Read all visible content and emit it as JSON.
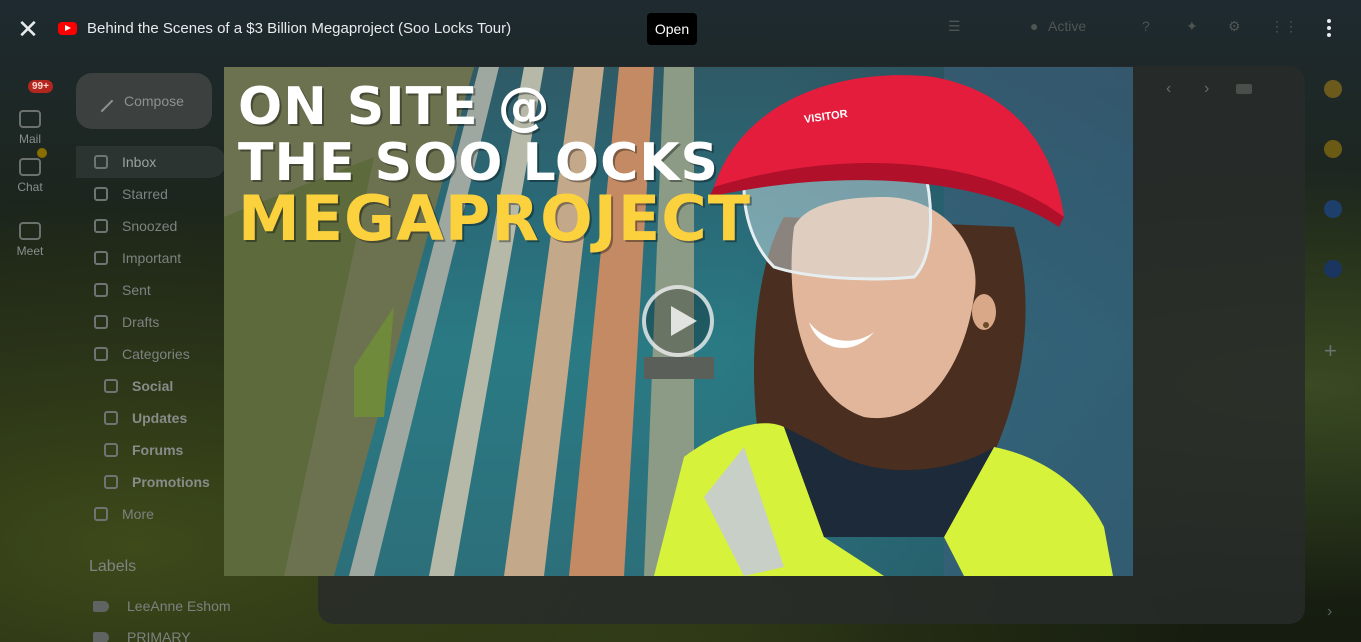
{
  "overlay": {
    "close_icon": "close-icon",
    "source_icon": "youtube-icon",
    "video_title": "Behind the Scenes of a $3 Billion Megaproject (Soo Locks Tour)",
    "open_label": "Open",
    "more_icon": "more-vertical-icon"
  },
  "thumbnail": {
    "line1": "ON SITE @",
    "line2": "THE SOO LOCKS",
    "line3": "MEGAPROJECT",
    "helmet_text": "VISITOR",
    "accent_color": "#fcd13e",
    "play_icon": "play-circle-icon"
  },
  "background": {
    "rail": [
      {
        "label": "Mail",
        "badge": "99+"
      },
      {
        "label": "Chat"
      },
      {
        "label": "Meet"
      }
    ],
    "topbar": {
      "status": "Active"
    },
    "compose_label": "Compose",
    "nav": [
      {
        "label": "Inbox",
        "active": true
      },
      {
        "label": "Starred"
      },
      {
        "label": "Snoozed"
      },
      {
        "label": "Important"
      },
      {
        "label": "Sent"
      },
      {
        "label": "Drafts"
      },
      {
        "label": "Categories"
      }
    ],
    "categories": [
      {
        "label": "Social"
      },
      {
        "label": "Updates"
      },
      {
        "label": "Forums"
      },
      {
        "label": "Promotions"
      }
    ],
    "more_label": "More",
    "labels_title": "Labels",
    "labels": [
      {
        "label": "LeeAnne Eshom"
      },
      {
        "label": "PRIMARY"
      }
    ]
  }
}
